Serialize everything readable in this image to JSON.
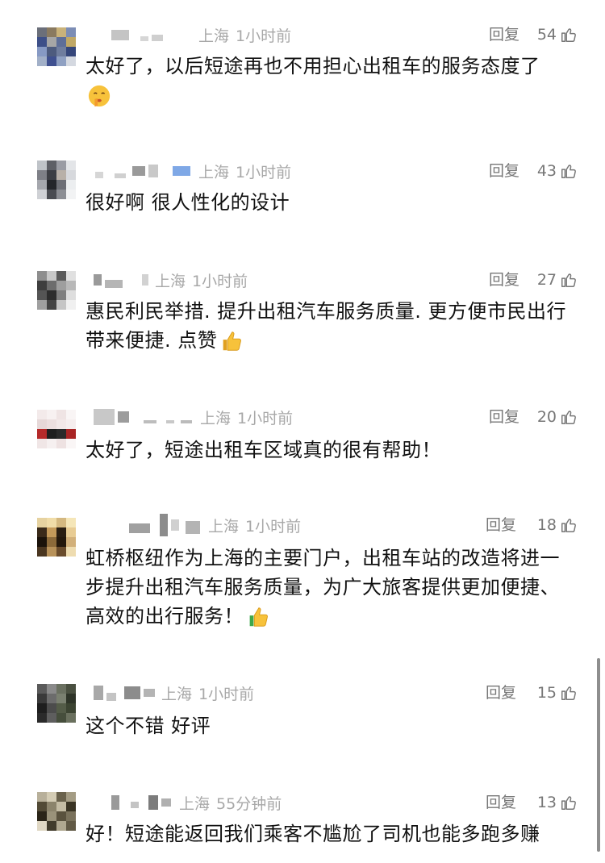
{
  "comments": [
    {
      "location": "上海",
      "time": "1小时前",
      "reply": "回复",
      "likes": "54",
      "text": "太好了，以后短途再也不用担心出租车的服务态度了",
      "emoji": "shushing-face-icon"
    },
    {
      "location": "上海",
      "time": "1小时前",
      "reply": "回复",
      "likes": "43",
      "text": "很好啊 很人性化的设计"
    },
    {
      "location": "上海",
      "time": "1小时前",
      "reply": "回复",
      "likes": "27",
      "text": "惠民利民举措. 提升出租汽车服务质量. 更方便市民出行带来便捷. 点赞",
      "emoji": "thumbs-up-icon"
    },
    {
      "location": "上海",
      "time": "1小时前",
      "reply": "回复",
      "likes": "20",
      "text": "太好了，短途出租车区域真的很有帮助！"
    },
    {
      "location": "上海",
      "time": "1小时前",
      "reply": "回复",
      "likes": "18",
      "text": "虹桥枢纽作为上海的主要门户，出租车站的改造将进一步提升出租汽车服务质量，为广大旅客提供更加便捷、高效的出行服务！",
      "emoji": "thumbs-up-icon"
    },
    {
      "location": "上海",
      "time": "1小时前",
      "reply": "回复",
      "likes": "15",
      "text": "这个不错  好评"
    },
    {
      "location": "上海",
      "time": "55分钟前",
      "reply": "回复",
      "likes": "13",
      "text": "好！短途能返回我们乘客不尴尬了司机也能多跑多赚"
    }
  ]
}
